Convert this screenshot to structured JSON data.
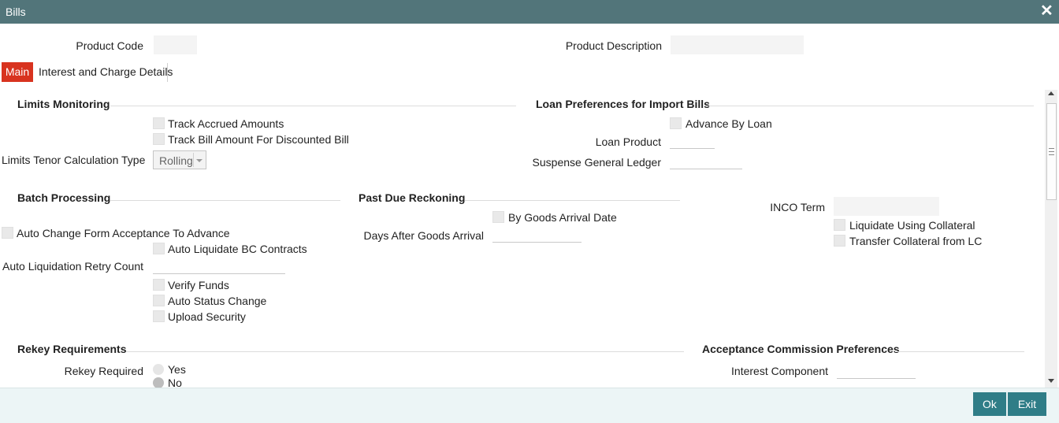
{
  "window": {
    "title": "Bills",
    "close_glyph": "✕"
  },
  "header": {
    "product_code_label": "Product Code",
    "product_code_value": "",
    "product_description_label": "Product Description",
    "product_description_value": ""
  },
  "tabs": [
    {
      "label": "Main",
      "active": true
    },
    {
      "label": "Interest and Charge Details",
      "active": false
    }
  ],
  "limits_monitoring": {
    "heading": "Limits Monitoring",
    "track_accrued": "Track Accrued Amounts",
    "track_bill_amount": "Track Bill Amount For Discounted Bill",
    "tenor_label": "Limits Tenor Calculation Type",
    "tenor_value": "Rolling"
  },
  "loan_preferences": {
    "heading": "Loan Preferences for Import Bills",
    "advance_by_loan": "Advance By Loan",
    "loan_product_label": "Loan Product",
    "loan_product_value": "",
    "suspense_gl_label": "Suspense General Ledger",
    "suspense_gl_value": ""
  },
  "batch_processing": {
    "heading": "Batch Processing",
    "auto_change": "Auto Change Form Acceptance To Advance",
    "auto_liquidate": "Auto Liquidate BC Contracts",
    "retry_label": "Auto Liquidation Retry Count",
    "retry_value": "",
    "verify_funds": "Verify Funds",
    "auto_status": "Auto Status Change",
    "upload_security": "Upload Security"
  },
  "past_due": {
    "heading": "Past Due Reckoning",
    "by_goods_arrival": "By Goods Arrival Date",
    "days_after_label": "Days After Goods Arrival",
    "days_after_value": ""
  },
  "inco": {
    "label": "INCO Term",
    "value": "",
    "liquidate_collateral": "Liquidate Using Collateral",
    "transfer_collateral": "Transfer Collateral from LC"
  },
  "rekey": {
    "heading": "Rekey Requirements",
    "required_label": "Rekey Required",
    "yes": "Yes",
    "no": "No",
    "selected": "No"
  },
  "acceptance_commission": {
    "heading": "Acceptance Commission Preferences",
    "interest_component_label": "Interest Component",
    "interest_component_value": ""
  },
  "footer": {
    "ok": "Ok",
    "exit": "Exit"
  },
  "colors": {
    "titlebar": "#52757a",
    "active_tab": "#d8331f",
    "button": "#2f7d87",
    "footer": "#ecf5f6"
  }
}
